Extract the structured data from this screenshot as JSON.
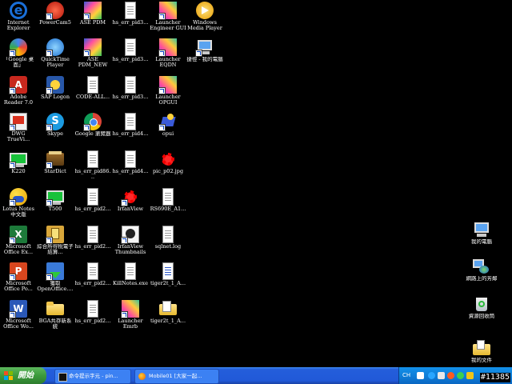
{
  "desktop": {
    "icons": [
      {
        "label": "Internet Explorer",
        "icon": "internet-explorer-icon",
        "sc": false
      },
      {
        "label": "PowerCam5",
        "icon": "powercam-icon",
        "sc": true
      },
      {
        "label": "ASE PDM",
        "icon": "ase-pdm-icon",
        "sc": true
      },
      {
        "label": "hs_err_pid3...",
        "icon": "document-icon",
        "sc": false
      },
      {
        "label": "Launcher Engineer GUI",
        "icon": "launcher-icon",
        "sc": true
      },
      {
        "label": "Windows Media Player",
        "icon": "media-player-icon",
        "sc": false
      },
      {
        "label": "「Google 桌面」",
        "icon": "google-desktop-icon",
        "sc": true
      },
      {
        "label": "QuickTime Player",
        "icon": "quicktime-icon",
        "sc": true
      },
      {
        "label": "ASE PDM_NEW",
        "icon": "ase-pdm-icon",
        "sc": true
      },
      {
        "label": "hs_err_pid3...",
        "icon": "document-icon",
        "sc": false
      },
      {
        "label": "Launcher EQDN",
        "icon": "launcher-icon",
        "sc": true
      },
      {
        "label": "捷徑 - 我的電腦",
        "icon": "my-computer-shortcut-icon",
        "sc": true
      },
      {
        "label": "Adobe Reader 7.0",
        "icon": "adobe-reader-icon",
        "sc": true
      },
      {
        "label": "SAP Logon",
        "icon": "sap-logon-icon",
        "sc": true
      },
      {
        "label": "CODE-ALL...",
        "icon": "document-icon",
        "sc": false
      },
      {
        "label": "hs_err_pid3...",
        "icon": "document-icon",
        "sc": false
      },
      {
        "label": "Launcher OPGUI",
        "icon": "launcher-icon",
        "sc": true
      },
      {
        "label": "DWG TrueVi...",
        "icon": "dwg-trueview-icon",
        "sc": true
      },
      {
        "label": "Skype",
        "icon": "skype-icon",
        "sc": true
      },
      {
        "label": "Google 瀏覽器",
        "icon": "chrome-icon",
        "sc": true
      },
      {
        "label": "hs_err_pid4...",
        "icon": "document-icon",
        "sc": false
      },
      {
        "label": "opui",
        "icon": "opui-icon",
        "sc": true
      },
      {
        "label": "K220",
        "icon": "k220-icon",
        "sc": true
      },
      {
        "label": "StarDict",
        "icon": "stardict-icon",
        "sc": true
      },
      {
        "label": "hs_err_pid86...",
        "icon": "document-icon",
        "sc": false
      },
      {
        "label": "hs_err_pid4...",
        "icon": "document-icon",
        "sc": false
      },
      {
        "label": "pic_p02.jpg",
        "icon": "image-file-icon",
        "sc": false
      },
      {
        "label": "Lotus Notes 中文版",
        "icon": "lotus-notes-icon",
        "sc": true
      },
      {
        "label": "T500",
        "icon": "t500-icon",
        "sc": true
      },
      {
        "label": "hs_err_pid2...",
        "icon": "document-icon",
        "sc": false
      },
      {
        "label": "IrfanView",
        "icon": "irfanview-icon",
        "sc": true
      },
      {
        "label": "RS690E_A1...",
        "icon": "document-icon",
        "sc": false
      },
      {
        "label": "Microsoft Office Ex...",
        "icon": "excel-icon",
        "sc": true
      },
      {
        "label": "綜合所得稅電子結算...",
        "icon": "tax-filing-icon",
        "sc": true
      },
      {
        "label": "hs_err_pid2...",
        "icon": "document-icon",
        "sc": false
      },
      {
        "label": "IrfanView Thumbnails",
        "icon": "irfanview-thumbnails-icon",
        "sc": true
      },
      {
        "label": "sqlnet.log",
        "icon": "document-icon",
        "sc": false
      },
      {
        "label": "Microsoft Office Po...",
        "icon": "powerpoint-icon",
        "sc": true
      },
      {
        "label": "獲取 OpenOffice....",
        "icon": "openoffice-icon",
        "sc": true
      },
      {
        "label": "hs_err_pid2...",
        "icon": "document-icon",
        "sc": false
      },
      {
        "label": "KillNotes.exe",
        "icon": "document-icon",
        "sc": false
      },
      {
        "label": "tiger2t_1_A...",
        "icon": "text-file-icon",
        "sc": false
      },
      {
        "label": "Microsoft Office Wo...",
        "icon": "word-icon",
        "sc": true
      },
      {
        "label": "BGA共存新系統",
        "icon": "folder-icon",
        "sc": false
      },
      {
        "label": "hs_err_pid2...",
        "icon": "document-icon",
        "sc": false
      },
      {
        "label": "Launcher Emrb",
        "icon": "launcher-icon",
        "sc": true
      },
      {
        "label": "tiger2t_1_A...",
        "icon": "folder-doc-icon",
        "sc": false
      },
      {
        "label": "我的電腦",
        "icon": "my-computer-icon",
        "sc": false
      },
      {
        "label": "網路上的芳鄰",
        "icon": "network-places-icon",
        "sc": false
      },
      {
        "label": "資源回收筒",
        "icon": "recycle-bin-icon",
        "sc": false
      },
      {
        "label": "我的文件",
        "icon": "my-documents-icon",
        "sc": false
      }
    ]
  },
  "taskbar": {
    "start_label": "開始",
    "tasks": [
      {
        "label": "命令提示字元 - pin...",
        "icon": "cmd-icon"
      },
      {
        "label": "Mobile01 [大家一起...",
        "icon": "firefox-icon"
      }
    ],
    "tray": {
      "lang": "CH"
    }
  },
  "watermark": "#11385",
  "colors": {
    "taskbar": "#245edb",
    "start": "#3c9a3c",
    "tray": "#0f7fd9",
    "desktop": "#000000"
  }
}
